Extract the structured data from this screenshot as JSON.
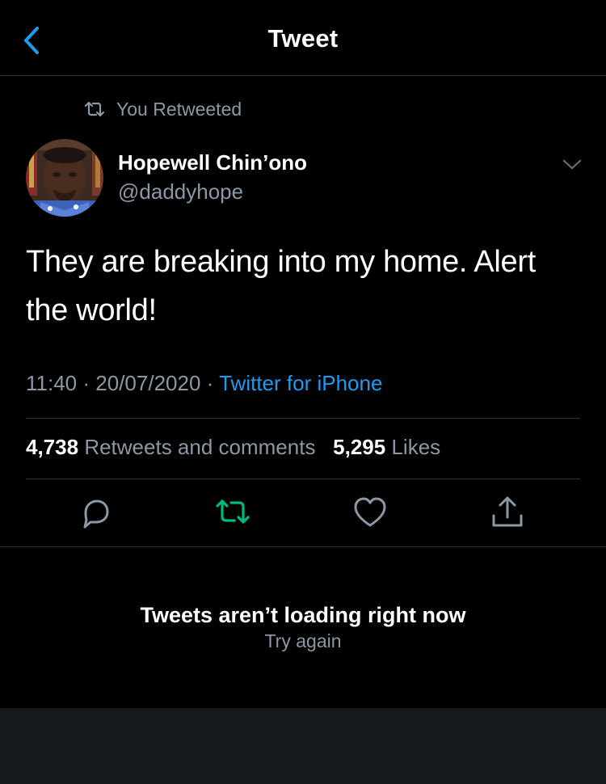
{
  "header": {
    "title": "Tweet",
    "back_icon": "chevron-left-icon"
  },
  "colors": {
    "background": "#000000",
    "accent": "#1d9bf0",
    "retweet_active": "#00ba7c",
    "secondary_text": "#8b98a5",
    "divider": "#2f3336"
  },
  "retweet_context": {
    "icon": "retweet-icon",
    "label": "You Retweeted"
  },
  "author": {
    "display_name": "Hopewell Chin’ono",
    "handle": "@daddyhope",
    "avatar_icon": "avatar"
  },
  "tweet": {
    "text": "They are breaking into my home. Alert the world!",
    "time": "11:40",
    "date": "20/07/2020",
    "separator": "·",
    "source": "Twitter for iPhone"
  },
  "stats": {
    "retweets_count": "4,738",
    "retweets_label": "Retweets and comments",
    "likes_count": "5,295",
    "likes_label": "Likes"
  },
  "actions": {
    "reply_icon": "reply-icon",
    "retweet_icon": "retweet-icon",
    "like_icon": "heart-icon",
    "share_icon": "share-icon",
    "retweeted": true
  },
  "error": {
    "title": "Tweets aren’t loading right now",
    "retry_label": "Try again"
  }
}
